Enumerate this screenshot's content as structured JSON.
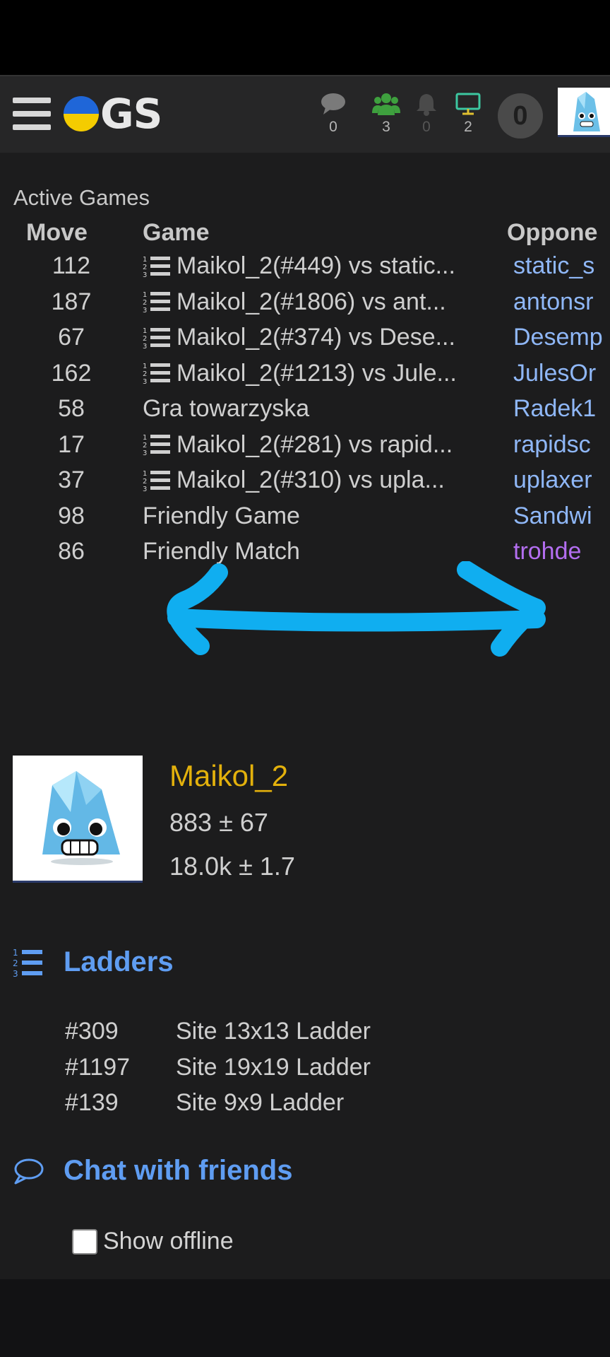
{
  "navbar": {
    "logo_text": "GS",
    "chat_count": "0",
    "friends_count": "3",
    "notifications_count": "0",
    "games_count": "2",
    "turn_count": "0",
    "colors": {
      "friends": "#3ea03e",
      "games": "#3cc7a0",
      "chat": "#7a7a7a"
    }
  },
  "active_games": {
    "title": "Active Games",
    "headers": {
      "move": "Move",
      "game": "Game",
      "opponent": "Oppone"
    },
    "rows": [
      {
        "move": "112",
        "game": "Maikol_2(#449) vs static...",
        "opponent": "static_s",
        "ladder": true
      },
      {
        "move": "187",
        "game": "Maikol_2(#1806) vs ant...",
        "opponent": "antonsr",
        "ladder": true
      },
      {
        "move": "67",
        "game": "Maikol_2(#374) vs Dese...",
        "opponent": "Desemp",
        "ladder": true
      },
      {
        "move": "162",
        "game": "Maikol_2(#1213) vs Jule...",
        "opponent": "JulesOr",
        "ladder": true
      },
      {
        "move": "58",
        "game": "Gra towarzyska",
        "opponent": "Radek1",
        "ladder": false
      },
      {
        "move": "17",
        "game": "Maikol_2(#281) vs rapid...",
        "opponent": "rapidsc",
        "ladder": true
      },
      {
        "move": "37",
        "game": "Maikol_2(#310) vs upla...",
        "opponent": "uplaxer",
        "ladder": true
      },
      {
        "move": "98",
        "game": "Friendly Game",
        "opponent": "Sandwi",
        "ladder": false
      },
      {
        "move": "86",
        "game": "Friendly Match",
        "opponent": "trohde",
        "ladder": false,
        "opponent_color": "purple"
      }
    ]
  },
  "profile": {
    "username": "Maikol_2",
    "rating": "883 ± 67",
    "rank": "18.0k ± 1.7"
  },
  "ladders": {
    "title": "Ladders",
    "items": [
      {
        "rank": "#309",
        "name": "Site 13x13 Ladder"
      },
      {
        "rank": "#1197",
        "name": "Site 19x19 Ladder"
      },
      {
        "rank": "#139",
        "name": "Site 9x9 Ladder"
      }
    ]
  },
  "chat": {
    "title": "Chat with friends",
    "show_offline_label": "Show offline"
  },
  "annotation": {
    "color": "#10aef0"
  }
}
